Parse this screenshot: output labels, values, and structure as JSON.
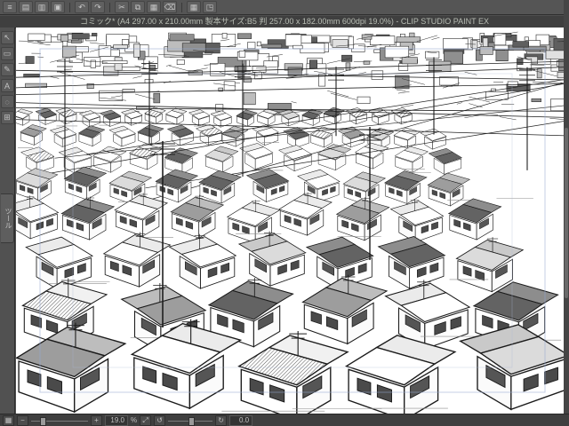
{
  "window": {
    "title": "コミック* (A4 297.00 x 210.00mm 製本サイズ:B5 判 257.00 x 182.00mm 600dpi 19.0%) - CLIP STUDIO PAINT EX"
  },
  "topbar": {
    "icons": [
      {
        "name": "main-menu",
        "glyph": "≡"
      },
      {
        "name": "new-canvas",
        "glyph": "▤"
      },
      {
        "name": "open-file",
        "glyph": "▥"
      },
      {
        "name": "save-file",
        "glyph": "▣"
      },
      {
        "name": "separator",
        "glyph": ""
      },
      {
        "name": "undo",
        "glyph": "↶"
      },
      {
        "name": "redo",
        "glyph": "↷"
      },
      {
        "name": "separator",
        "glyph": ""
      },
      {
        "name": "cut",
        "glyph": "✂"
      },
      {
        "name": "copy",
        "glyph": "⧉"
      },
      {
        "name": "paste",
        "glyph": "▦"
      },
      {
        "name": "delete",
        "glyph": "⌫"
      },
      {
        "name": "separator",
        "glyph": ""
      },
      {
        "name": "grid-toggle",
        "glyph": "▦"
      },
      {
        "name": "snap-toggle",
        "glyph": "◳"
      }
    ]
  },
  "left_toolbar": {
    "icons": [
      {
        "name": "select-arrow",
        "glyph": "↖"
      },
      {
        "name": "marquee-select",
        "glyph": "▭"
      },
      {
        "name": "pen-tool",
        "glyph": "✎"
      },
      {
        "name": "text-tool",
        "glyph": "A"
      },
      {
        "name": "eyedropper-tool",
        "glyph": "◌"
      },
      {
        "name": "grid-tool",
        "glyph": "⊞"
      }
    ],
    "palette_tab_label": "ツール"
  },
  "statusbar": {
    "zoom_value": "19.0",
    "zoom_unit": "%",
    "rotation_value": "0.0"
  },
  "colors": {
    "chrome": "#4f4f4f",
    "titlebar": "#3f3f3f",
    "canvas_paper": "#ffffff",
    "line_art": "#1b1b1b",
    "guide": "#93a7d1"
  }
}
